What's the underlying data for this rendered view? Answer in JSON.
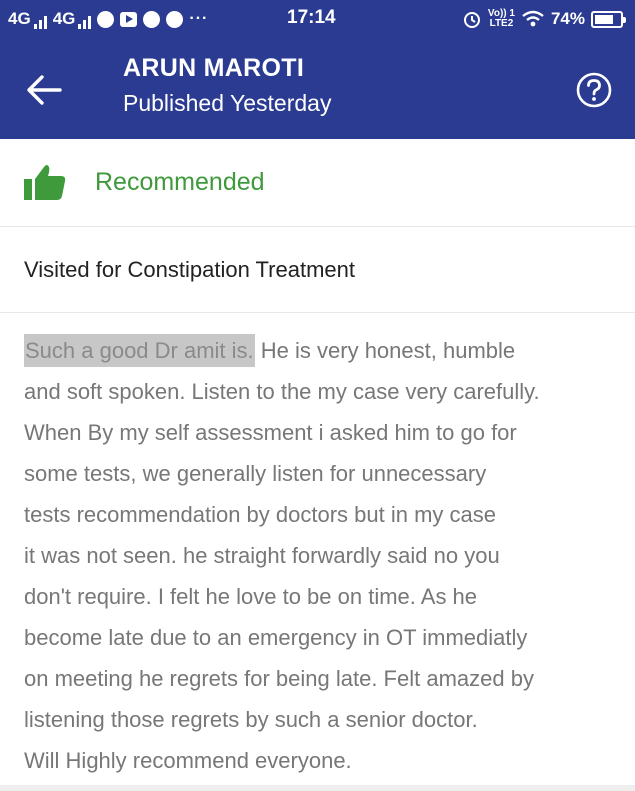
{
  "status_bar": {
    "network_1": "4G",
    "network_2": "4G",
    "time": "17:14",
    "more": "···",
    "volte_top": "Vo)) 1",
    "volte_bottom": "LTE2",
    "battery": "74%",
    "battery_level": 0.74
  },
  "app_bar": {
    "title": "ARUN MAROTI",
    "subtitle": "Published Yesterday"
  },
  "recommendation": {
    "label": "Recommended",
    "color": "#3f9a3c"
  },
  "visited": {
    "label": "Visited for Constipation Treatment"
  },
  "review": {
    "highlight": "Such a good Dr amit is.",
    "line1_rest": " He is very honest, humble",
    "lines": [
      "and soft spoken. Listen to the my case very carefully.",
      "When By my self assessment i asked him to go for",
      "some tests,  we generally listen for unnecessary",
      "tests recommendation by doctors but in my case",
      "it was not seen.  he straight forwardly said no you",
      "don't require. I felt he love to be on time. As he",
      "become late due to an emergency in OT immediatly",
      "on meeting he regrets for being late. Felt amazed by",
      "listening those regrets by such a senior doctor.",
      "Will Highly recommend everyone."
    ]
  },
  "colors": {
    "header": "#2a3b91",
    "text_muted": "#777777",
    "highlight_bg": "#c7c7c7"
  }
}
